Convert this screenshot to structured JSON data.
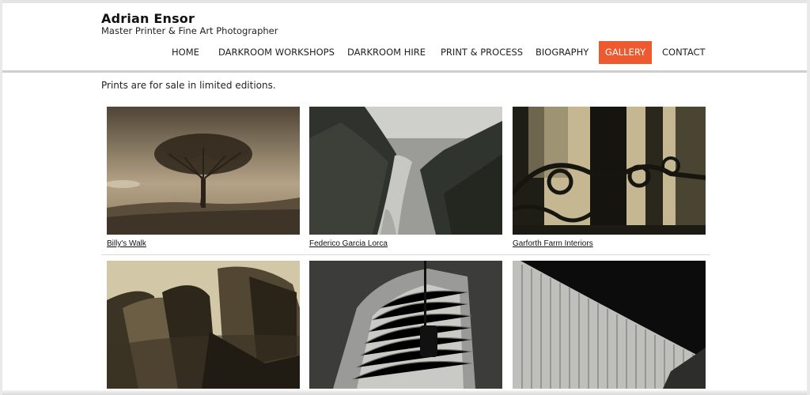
{
  "site": {
    "title": "Adrian Ensor",
    "subtitle": "Master Printer & Fine Art Photographer"
  },
  "nav": {
    "items": [
      {
        "label": "HOME"
      },
      {
        "label": "DARKROOM WORKSHOPS"
      },
      {
        "label": "DARKROOM HIRE"
      },
      {
        "label": "PRINT & PROCESS"
      },
      {
        "label": "BIOGRAPHY"
      },
      {
        "label": "GALLERY",
        "active": true
      },
      {
        "label": "CONTACT"
      }
    ]
  },
  "main": {
    "intro": "Prints are for sale in limited editions.",
    "gallery": [
      {
        "caption": "Billy's Walk",
        "subject": "tree-photo"
      },
      {
        "caption": "Federico Garcia Lorca",
        "subject": "river-photo"
      },
      {
        "caption": "Garforth Farm Interiors",
        "subject": "shadow-photo"
      },
      {
        "caption": "",
        "subject": "architecture-photo"
      },
      {
        "caption": "",
        "subject": "building-photo"
      },
      {
        "caption": "",
        "subject": "facade-photo"
      }
    ]
  },
  "colors": {
    "accent": "#ee5a2f",
    "header_rule": "#cfcfcf",
    "text": "#222222"
  }
}
